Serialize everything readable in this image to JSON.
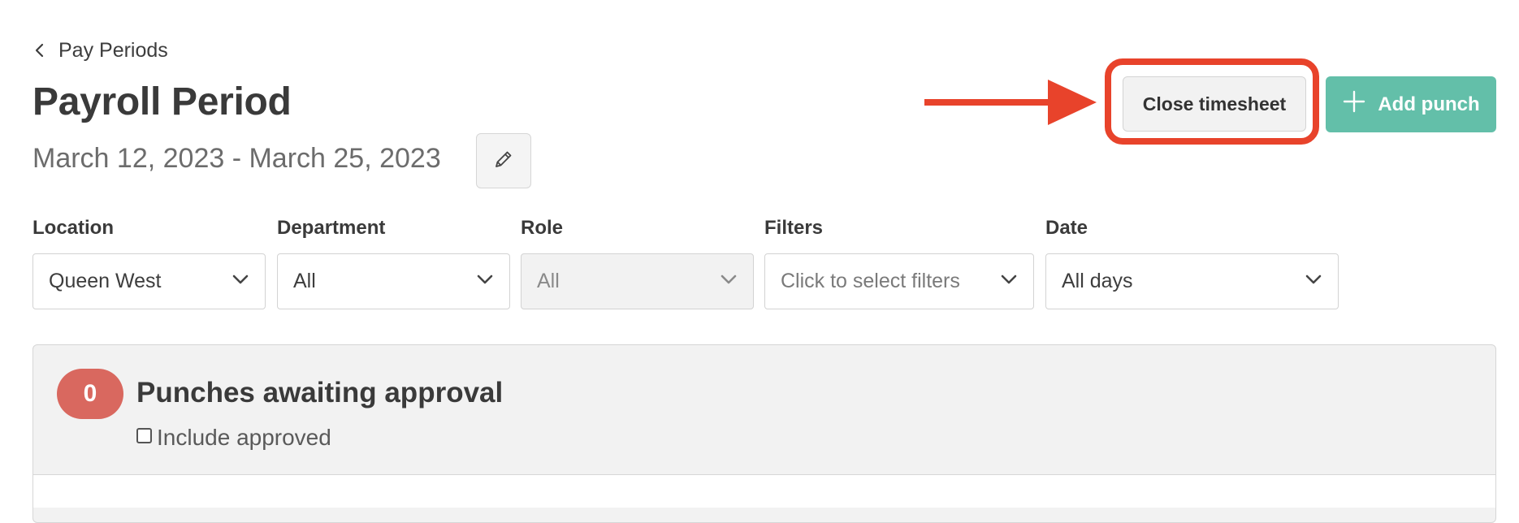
{
  "breadcrumb": {
    "label": "Pay Periods"
  },
  "header": {
    "title": "Payroll Period",
    "date_range": "March 12, 2023 - March 25, 2023"
  },
  "actions": {
    "close_timesheet_label": "Close timesheet",
    "add_punch_label": "Add punch"
  },
  "filters": [
    {
      "label": "Location",
      "value": "Queen West",
      "disabled": false
    },
    {
      "label": "Department",
      "value": "All",
      "disabled": false
    },
    {
      "label": "Role",
      "value": "All",
      "disabled": true
    },
    {
      "label": "Filters",
      "value": "Click to select filters",
      "placeholder": true,
      "disabled": false
    },
    {
      "label": "Date",
      "value": "All days",
      "disabled": false
    }
  ],
  "approval_panel": {
    "count": "0",
    "title": "Punches awaiting approval",
    "include_approved_label": "Include approved",
    "include_approved_checked": false
  },
  "colors": {
    "accent_green": "#63bfa9",
    "annotation_red": "#e8432b",
    "badge_red": "#d9685f"
  },
  "icons": {
    "back": "chevron-left-icon",
    "edit": "pencil-icon",
    "add": "plus-icon",
    "dropdown": "chevron-down-icon"
  }
}
